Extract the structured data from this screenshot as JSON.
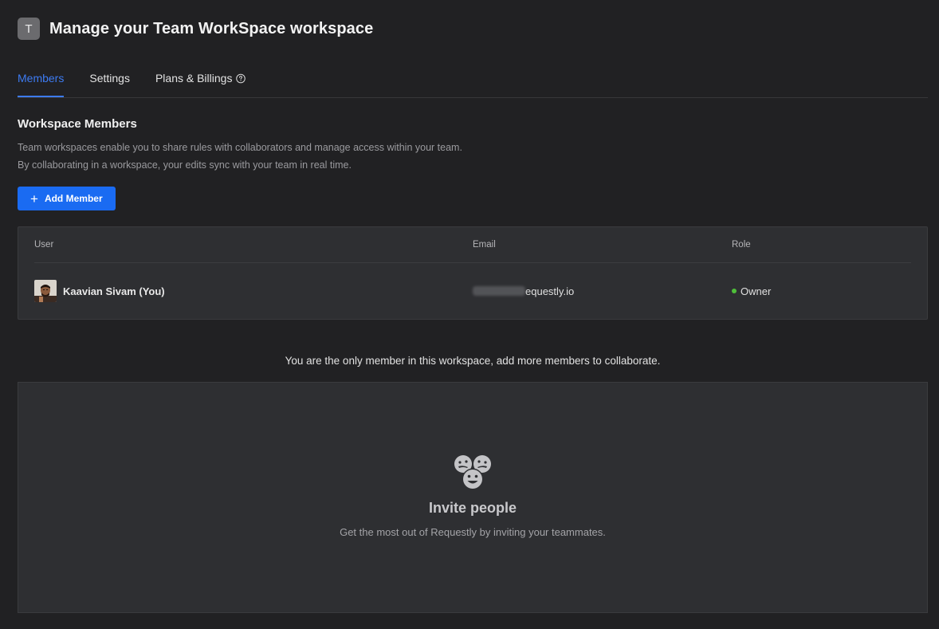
{
  "header": {
    "workspace_initial": "T",
    "title": "Manage your Team WorkSpace workspace"
  },
  "tabs": [
    {
      "label": "Members",
      "active": true
    },
    {
      "label": "Settings",
      "active": false
    },
    {
      "label": "Plans & Billings",
      "active": false,
      "icon": "help-circle-icon"
    }
  ],
  "section": {
    "title": "Workspace Members",
    "desc_line1": "Team workspaces enable you to share rules with collaborators and manage access within your team.",
    "desc_line2": "By collaborating in a workspace, your edits sync with your team in real time.",
    "add_button_label": "Add Member"
  },
  "table": {
    "headers": {
      "user": "User",
      "email": "Email",
      "role": "Role"
    },
    "rows": [
      {
        "user": "Kaavian Sivam (You)",
        "email_visible": "equestly.io",
        "role": "Owner",
        "role_status_color": "#4fbf3a"
      }
    ]
  },
  "only_member_message": "You are the only member in this workspace, add more members to collaborate.",
  "invite": {
    "icon": "people-faces-icon",
    "title": "Invite people",
    "subtitle": "Get the most out of Requestly by inviting your teammates."
  },
  "colors": {
    "accent": "#1a6bf2",
    "tab_active": "#3d7bf2",
    "background": "#212123",
    "panel": "#2e2f32"
  }
}
